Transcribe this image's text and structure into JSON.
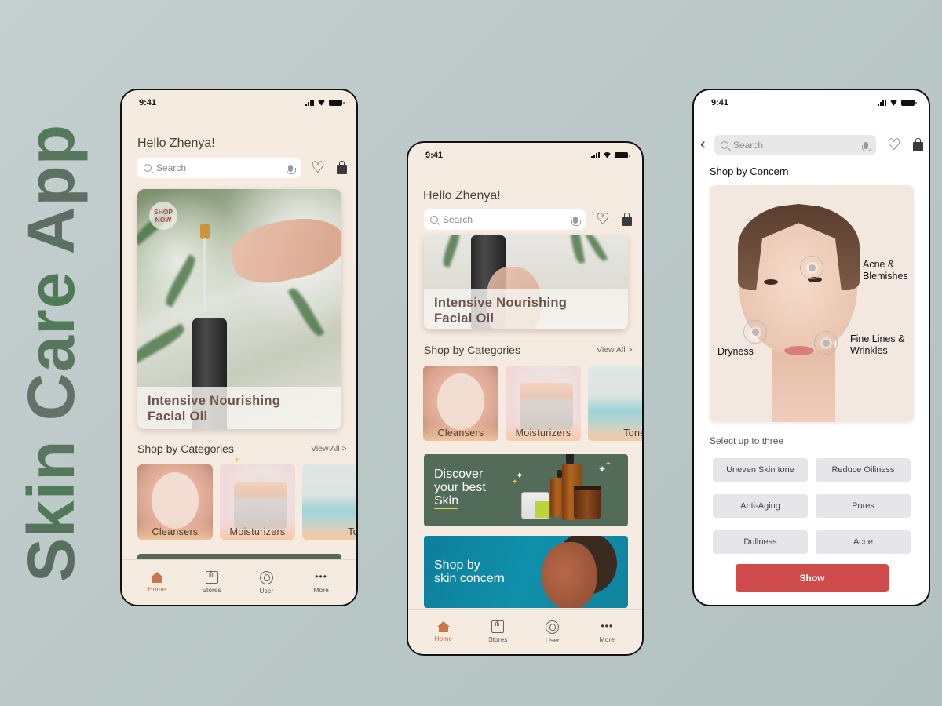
{
  "brand": {
    "title": "Skin Care App"
  },
  "status_bar": {
    "time": "9:41"
  },
  "home": {
    "greeting": "Hello Zhenya!",
    "search_placeholder": "Search",
    "hero": {
      "badge": "SHOP NOW",
      "title_line1": "Intensive Nourishing",
      "title_line2": "Facial Oil"
    },
    "categories_title": "Shop by Categories",
    "view_all": "View All >",
    "categories": [
      {
        "label": "Cleansers"
      },
      {
        "label": "Moisturizers"
      },
      {
        "label": "Toner"
      }
    ],
    "banners": {
      "discover": {
        "line1": "Discover",
        "line2": "your best",
        "line3": "Skin"
      },
      "concern": {
        "line1": "Shop by",
        "line2": "skin concern"
      }
    },
    "nav": [
      {
        "label": "Home",
        "icon": "home-icon",
        "active": true
      },
      {
        "label": "Stores",
        "icon": "stores-icon",
        "active": false
      },
      {
        "label": "User",
        "icon": "user-icon",
        "active": false
      },
      {
        "label": "More",
        "icon": "more-icon",
        "active": false
      }
    ]
  },
  "concern": {
    "search_placeholder": "Search",
    "title": "Shop by Concern",
    "hotspots": [
      {
        "label_line1": "Acne &",
        "label_line2": "Blemishes"
      },
      {
        "label_line1": "Dryness",
        "label_line2": ""
      },
      {
        "label_line1": "Fine Lines &",
        "label_line2": "Wrinkles"
      }
    ],
    "select_label": "Select up to three",
    "chips": [
      "Uneven Skin tone",
      "Reduce Oiliness",
      "Anti-Aging",
      "Pores",
      "Dullness",
      "Acne"
    ],
    "show_button": "Show"
  },
  "colors": {
    "background": "#bcc8c8",
    "screen_bg": "#f6ebe1",
    "accent_nav": "#c36e45",
    "banner_green": "#536b59",
    "banner_blue": "#0f88a3",
    "show_button": "#cf4a4a",
    "chip_bg": "#e6e6ea"
  }
}
